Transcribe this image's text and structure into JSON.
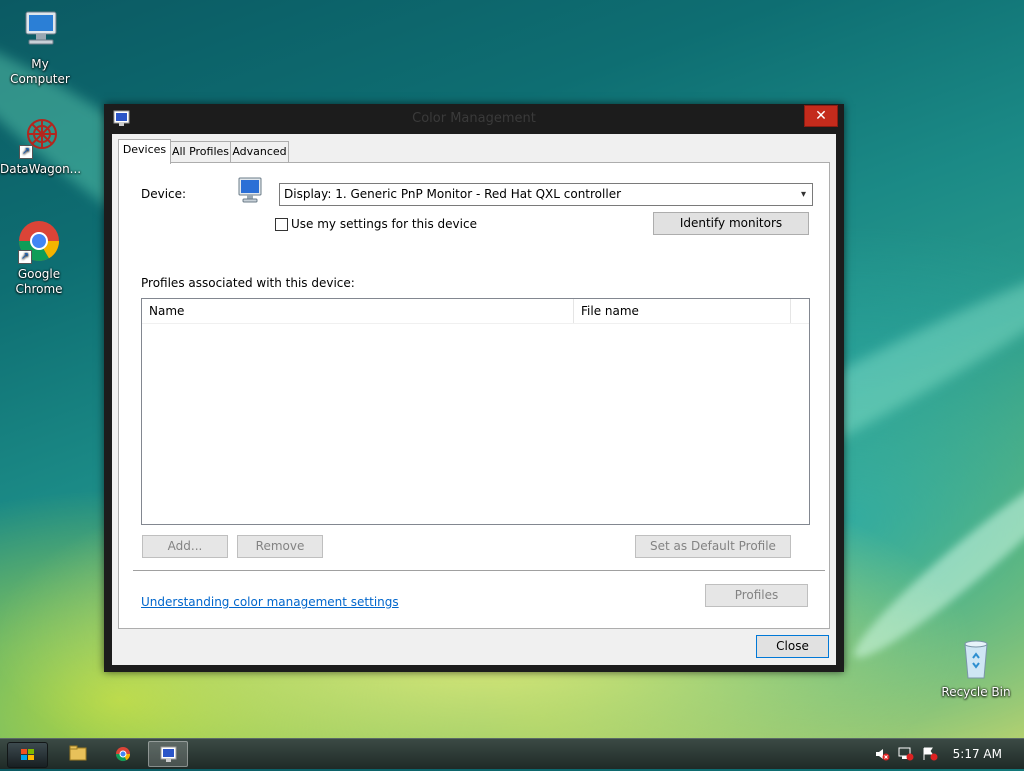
{
  "desktop": {
    "icons": [
      {
        "label": "My Computer"
      },
      {
        "label": "DataWagon..."
      },
      {
        "label": "Google Chrome"
      },
      {
        "label": "Recycle Bin"
      }
    ]
  },
  "window": {
    "title": "Color Management",
    "close_glyph": "✕",
    "tabs": [
      "Devices",
      "All Profiles",
      "Advanced"
    ],
    "active_tab": "Devices",
    "device_label": "Device:",
    "device_value": "Display: 1. Generic PnP Monitor - Red Hat QXL controller",
    "use_settings_label": "Use my settings for this device",
    "use_settings_checked": false,
    "identify_button": "Identify monitors",
    "profiles_label": "Profiles associated with this device:",
    "columns": [
      "Name",
      "File name"
    ],
    "rows": [],
    "add_button": "Add...",
    "remove_button": "Remove",
    "set_default_button": "Set as Default Profile",
    "link": "Understanding color management settings",
    "profiles_button": "Profiles",
    "close_button": "Close"
  },
  "taskbar": {
    "clock": "5:17 AM",
    "icons": [
      "start-orb-icon",
      "file-explorer-icon",
      "chrome-icon",
      "color-management-icon"
    ],
    "tray": [
      "volume-muted-icon",
      "network-icon",
      "action-center-icon"
    ]
  },
  "colors": {
    "close_red": "#c42b1c",
    "link_blue": "#0066cc",
    "window_frame": "#1c1c1c"
  }
}
